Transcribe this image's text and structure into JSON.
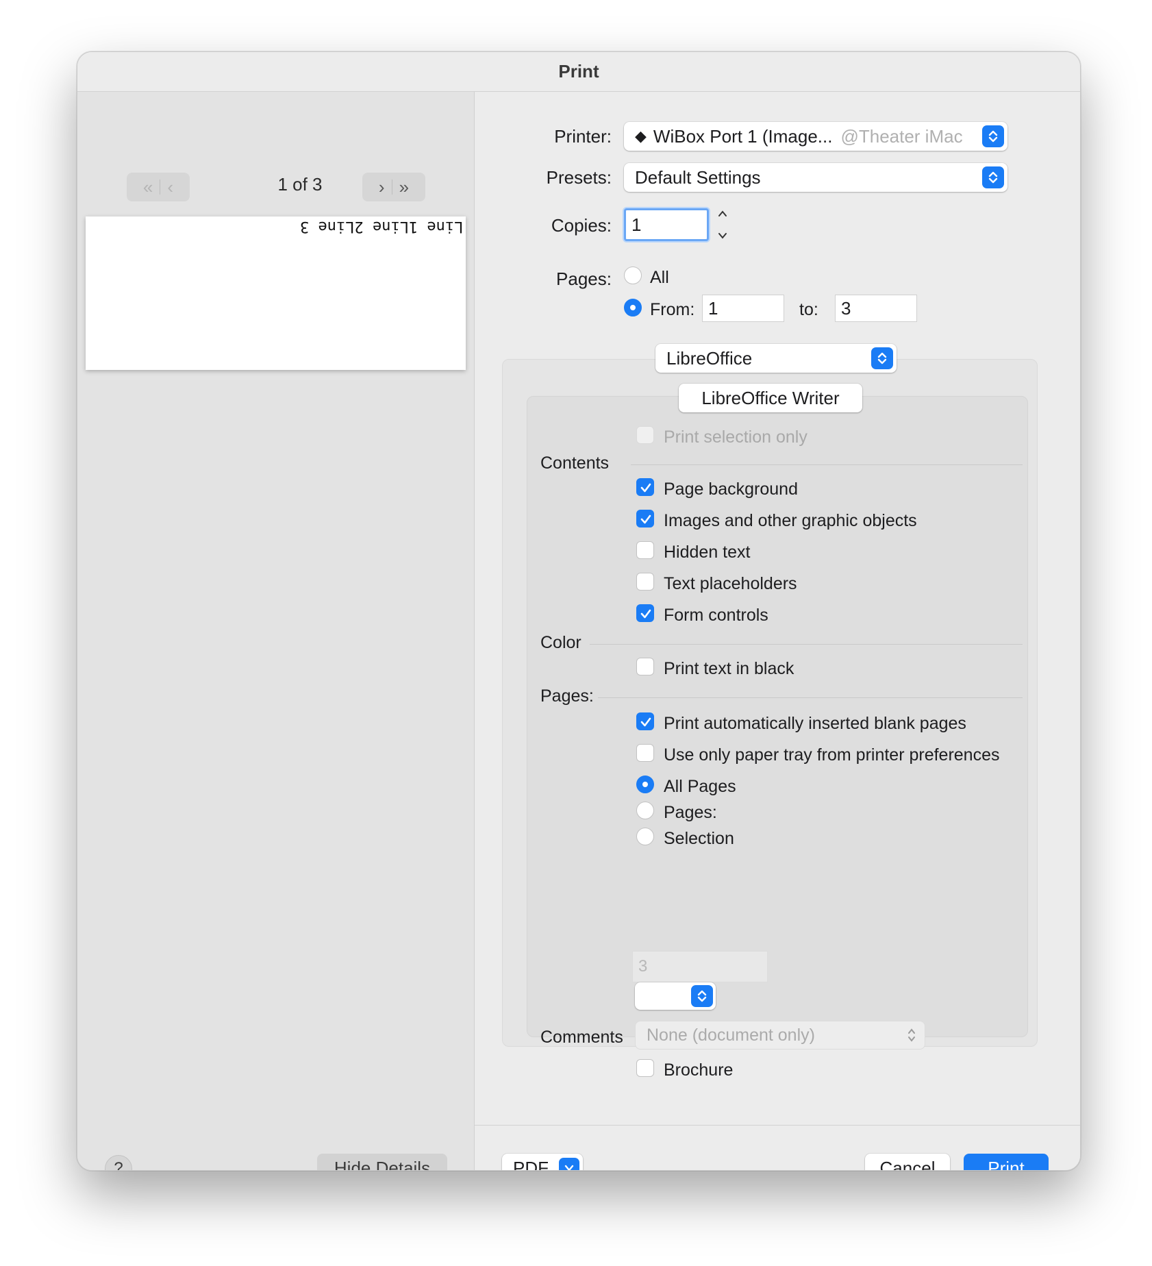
{
  "window": {
    "title": "Print"
  },
  "preview": {
    "page_indicator": "1 of 3",
    "page_text": "Line 1Line 2Line 3"
  },
  "left_footer": {
    "help": "?",
    "hide_details": "Hide Details"
  },
  "printer": {
    "label": "Printer:",
    "value": "WiBox Port 1 (Image...",
    "host": "@Theater iMac",
    "icon": "diamond-printer-icon"
  },
  "presets": {
    "label": "Presets:",
    "value": "Default Settings"
  },
  "copies": {
    "label": "Copies:",
    "value": "1"
  },
  "pages_range": {
    "label": "Pages:",
    "all_label": "All",
    "from_label": "From:",
    "from_value": "1",
    "to_label": "to:",
    "to_value": "3",
    "selected": "from"
  },
  "app_menu": {
    "value": "LibreOffice"
  },
  "segment": {
    "label": "LibreOffice Writer"
  },
  "writer": {
    "print_selection_only": {
      "label": "Print selection only",
      "checked": false,
      "enabled": false
    },
    "contents": {
      "heading": "Contents",
      "items": [
        {
          "label": "Page background",
          "checked": true
        },
        {
          "label": "Images and other graphic objects",
          "checked": true
        },
        {
          "label": "Hidden text",
          "checked": false
        },
        {
          "label": "Text placeholders",
          "checked": false
        },
        {
          "label": "Form controls",
          "checked": true
        }
      ]
    },
    "color": {
      "heading": "Color",
      "items": [
        {
          "label": "Print text in black",
          "checked": false
        }
      ]
    },
    "pages": {
      "heading": "Pages:",
      "checks": [
        {
          "label": "Print automatically inserted blank pages",
          "checked": true
        },
        {
          "label": "Use only paper tray from printer preferences",
          "checked": false
        }
      ],
      "radios": [
        {
          "label": "All Pages",
          "selected": true
        },
        {
          "label": "Pages:",
          "selected": false
        },
        {
          "label": "Selection",
          "selected": false
        }
      ],
      "range_field": "3"
    },
    "comments": {
      "label": "Comments",
      "value": "None (document only)"
    },
    "brochure": {
      "label": "Brochure",
      "checked": false
    }
  },
  "footer": {
    "pdf": "PDF",
    "cancel": "Cancel",
    "print": "Print"
  },
  "colors": {
    "accent": "#1a7cf5",
    "window_bg": "#ececec",
    "sidebar_bg": "#e3e3e3"
  }
}
